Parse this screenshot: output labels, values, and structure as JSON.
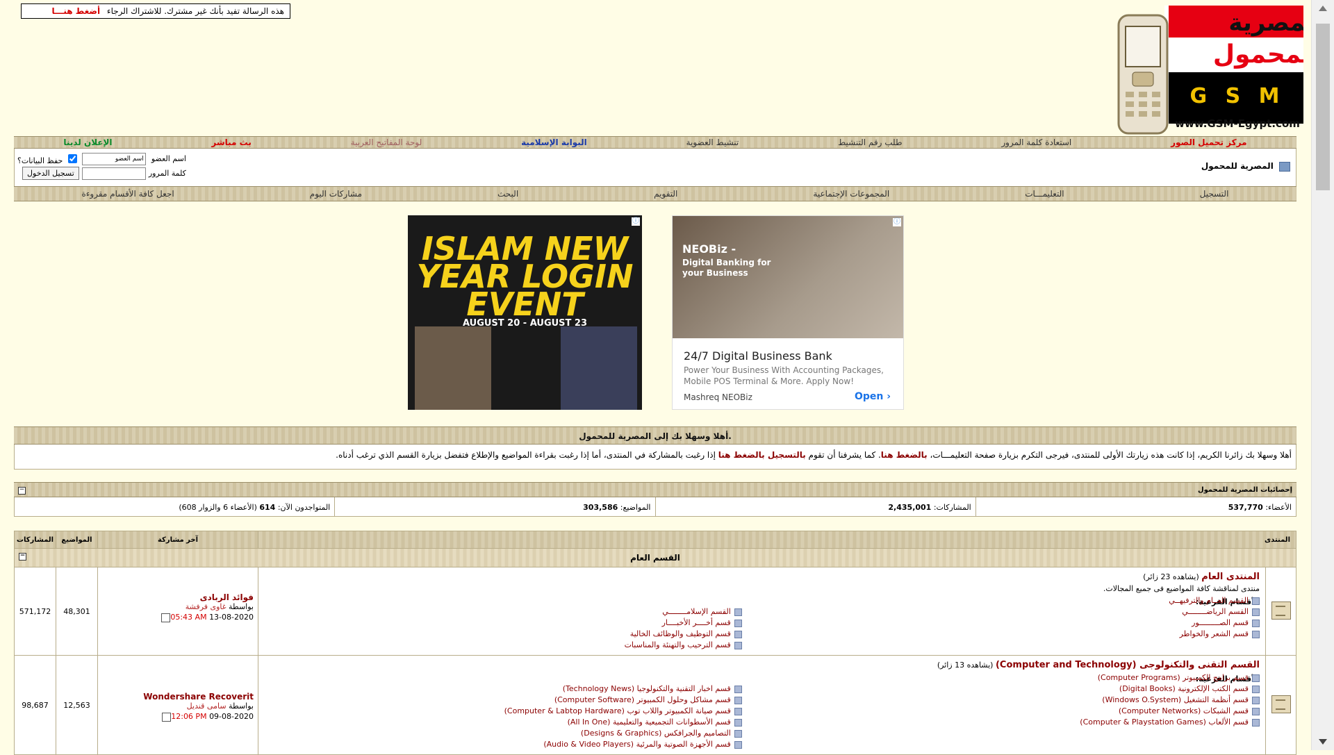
{
  "notice": {
    "text": "هذه الرسالة تفيد بأنك غير مشترك. للاشتراك الرجاء",
    "link": "أضغط هنـــا"
  },
  "logo": {
    "line1": "المصرية",
    "line2": "للمحمول",
    "gsm": "G S M",
    "domain": "www.GSM-Egypt.com"
  },
  "topnav": [
    "مركز تحميل الصور",
    "استعادة كلمة المرور",
    "طلب رقم التنشيط",
    "تنشيط العضوية",
    "البوابة الإسلامية",
    "لوحة المفاتيح العربية",
    "بث مباشر",
    "الإعلان لدينا"
  ],
  "breadcrumb": "المصرية للمحمول",
  "login": {
    "username_label": "اسم العضو",
    "username_value": "اسم العضو",
    "remember_label": "حفظ البيانات؟",
    "password_label": "كلمة المرور",
    "submit_label": "تسجيل الدخول"
  },
  "subnav": [
    "التسجيل",
    "التعليمـــات",
    "المجموعات الإجتماعية",
    "التقويم",
    "البحث",
    "مشاركات اليوم",
    "اجعل كافة الأقسام مقروءة"
  ],
  "ads": {
    "ad1": {
      "title": "ISLAM NEW YEAR LOGIN EVENT",
      "dates": "AUGUST 20 - AUGUST 23"
    },
    "ad2": {
      "image_title": "NEOBiz -",
      "image_sub": "Digital Banking for your Business",
      "headline": "24/7 Digital Business Bank",
      "text": "Power Your Business With Accounting Packages, Mobile POS Terminal & More. Apply Now!",
      "brand": "Mashreq NEOBiz",
      "cta": "Open"
    }
  },
  "welcome": {
    "title": "أهلا وسهلا بك إلى المصرية للمحمول.",
    "p1": "أهلا وسهلا بك زائرنا الكريم، إذا كانت هذه زيارتك الأولى للمنتدى، فيرجى التكرم بزيارة صفحة التعليمـــات،",
    "l1": "بالضغط هنا",
    "p2": ". كما يشرفنا أن تقوم",
    "l2": "بالتسجيل بالضغط هنا",
    "p3": "إذا رغبت بالمشاركة في المنتدى، أما إذا رغبت بقراءة المواضيع والإطلاع فتفضل بزيارة القسم الذي ترغب أدناه."
  },
  "stats": {
    "title": "إحصائيات المصرية للمحمول",
    "members_label": "الأعضاء:",
    "members": "537,770",
    "posts_label": "المشاركات:",
    "posts": "2,435,001",
    "threads_label": "المواضيع:",
    "threads": "303,586",
    "online_label": "المتواجدون الآن:",
    "online": "614",
    "online_detail": "(الأعضاء 6 والزوار 608)"
  },
  "table": {
    "headers": {
      "forum": "المنتدى",
      "last_post": "آخر مشاركة",
      "threads": "المواضيع",
      "posts": "المشاركات"
    },
    "category": "القسم العام",
    "forums": [
      {
        "title": "المنتدى العام",
        "views": "(يشاهده 23 زائر)",
        "desc": "منتدى لمناقشة كافة المواضيع فى جميع المجالات.",
        "sub_label": "الأقسام الفرعية:",
        "subs_right": [
          "القسم الإسلامــــــــي",
          "قسم أخــــر الأخبــــار",
          "قسم التوظيف والوظائف الخالية",
          "قسم الترحيب والتهنئة والمناسبات"
        ],
        "subs_left": [
          "القسم العــام والترفيهــي",
          "القسم الرياضــــــــي",
          "قسم الصـــــــــور",
          "قسم الشعر والخواطر"
        ],
        "last": {
          "title": "فوائد الربادى",
          "by": "بواسطة",
          "user": "غاوى فرفشة",
          "date": "13-08-2020",
          "time": "05:43 AM"
        },
        "threads": "48,301",
        "posts": "571,172"
      },
      {
        "title": "القسم التقنى والتكنولوجى (Computer and Technology)",
        "views": "(يشاهده 13 زائر)",
        "desc": "",
        "sub_label": "الأقسام الفرعية:",
        "subs_right": [
          "قسم اخبار التقنية والتكنولوجيا (Technology News)",
          "قسم مشاكل وحلول الكمبيوتر (Computer Software)",
          "قسم صيانة الكمبيوتر واللاب توب (Computer & Labtop Hardware)",
          "قسم الأسطوانات التجميعية والتعليمية (All In One)",
          "التصاميم والجرافكس (Designs & Graphics)",
          "قسم الأجهزة الصوتية والمرئية (Audio & Video Players)"
        ],
        "subs_left": [
          "قسم برامج الكمبيوتر (Computer Programs)",
          "قسم الكتب الإلكترونية (Digital Books)",
          "قسم أنظمة التشغيل (Windows O.System)",
          "قسم الشبكات (Computer Networks)",
          "قسم الألعاب (Computer & Playstation Games)"
        ],
        "last": {
          "title": "Wondershare Recoverit",
          "by": "بواسطة",
          "user": "سامى قنديل",
          "date": "09-08-2020",
          "time": "12:06 PM"
        },
        "threads": "12,563",
        "posts": "98,687"
      }
    ]
  }
}
